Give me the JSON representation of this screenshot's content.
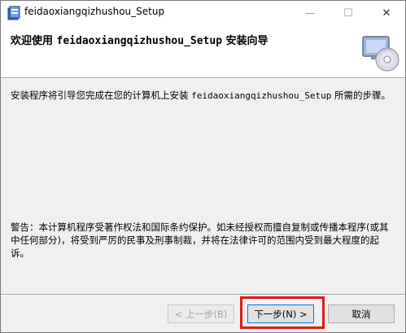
{
  "window": {
    "title": "feidaoxiangqizhushou_Setup",
    "minimize_glyph": "—",
    "maximize_glyph": "☐",
    "close_glyph": "✕"
  },
  "header": {
    "title_prefix": "欢迎使用 ",
    "title_app": "feidaoxiangqizhushou_Setup",
    "title_suffix": " 安装向导"
  },
  "body": {
    "description_prefix": "安装程序将引导您完成在您的计算机上安装 ",
    "description_app": "feidaoxiangqizhushou_Setup",
    "description_suffix": " 所需的步骤。",
    "warning": "警告：本计算机程序受著作权法和国际条约保护。如未经授权而擅自复制或传播本程序(或其中任何部分)，将受到严厉的民事及刑事制裁，并将在法律许可的范围内受到最大程度的起诉。"
  },
  "buttons": {
    "back": "< 上一步(B)",
    "next": "下一步(N) >",
    "cancel": "取消"
  },
  "icons": {
    "app": "installer-app-icon",
    "header": "cd-disc-computer-icon"
  },
  "colors": {
    "highlight": "#e01a1a",
    "primary_border": "#0078d7"
  }
}
